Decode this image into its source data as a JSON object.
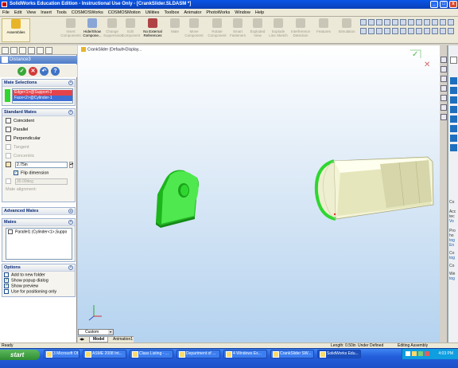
{
  "window": {
    "title": "SolidWorks Education Edition - Instructional Use Only - [CrankSlider.SLDASM *]",
    "minimize": "_",
    "maximize": "□",
    "close": "x"
  },
  "menu": [
    "File",
    "Edit",
    "View",
    "Insert",
    "Tools",
    "COSMOSWorks",
    "COSMOSMotion",
    "Utilities",
    "Toolbox",
    "Animator",
    "PhotoWorks",
    "Window",
    "Help"
  ],
  "toolbar": {
    "assemblies": "Assemblies",
    "buttons": [
      {
        "label": "Insert Components",
        "enabled": false
      },
      {
        "label": "Hide/Show Compone...",
        "enabled": true
      },
      {
        "label": "Change Suppression",
        "enabled": false
      },
      {
        "label": "Edit Component",
        "enabled": false
      },
      {
        "label": "No External References",
        "enabled": true
      },
      {
        "label": "Mate",
        "enabled": false
      },
      {
        "label": "Move Component",
        "enabled": false
      },
      {
        "label": "Rotate Component",
        "enabled": false
      },
      {
        "label": "Smart Fasteners",
        "enabled": false
      },
      {
        "label": "Exploded View",
        "enabled": false
      },
      {
        "label": "Explode Line Sketch",
        "enabled": false
      },
      {
        "label": "Interference Detection",
        "enabled": false
      },
      {
        "label": "Features",
        "enabled": false
      },
      {
        "label": "Simulation",
        "enabled": false
      }
    ]
  },
  "property_manager": {
    "title": "Distance3",
    "mate_selections": {
      "header": "Mate Selections",
      "items": [
        "Edge<1>@Support-3",
        "Face<2>@Cylinder-1"
      ]
    },
    "standard_mates": {
      "header": "Standard Mates",
      "coincident": "Coincident",
      "parallel": "Parallel",
      "perpendicular": "Perpendicular",
      "tangent": "Tangent",
      "concentric": "Concentric",
      "distance_value": "2.75in",
      "flip_dimension": "Flip dimension",
      "angle_value": "30.00deg",
      "mate_alignment": "Mate alignment:"
    },
    "advanced_mates": {
      "header": "Advanced Mates"
    },
    "mates": {
      "header": "Mates",
      "items": [
        "Parallel1 (Cylinder<1>,Suppo"
      ]
    },
    "options": {
      "header": "Options",
      "items": [
        {
          "label": "Add to new folder",
          "checked": false
        },
        {
          "label": "Show popup dialog",
          "checked": true
        },
        {
          "label": "Show preview",
          "checked": true
        },
        {
          "label": "Use for positioning only",
          "checked": false
        }
      ]
    }
  },
  "viewport": {
    "breadcrumb": "CrankSlider (Default<Display...",
    "view_dropdown": "Custom",
    "tabs": [
      "Model",
      "Animation1"
    ]
  },
  "task_pane": {
    "items": [
      "Co",
      "Acc",
      "tec",
      "Vo",
      "Pro",
      "ho",
      "tog",
      "En",
      "Co",
      "tog",
      "Co",
      "We",
      "tog"
    ]
  },
  "status": {
    "left": "Ready",
    "length": "Length: 0.50in",
    "defined": "Under Defined",
    "mode": "Editing Assembly"
  },
  "taskbar": {
    "start": "start",
    "items": [
      "3 Microsoft Of...",
      "ASME 2008 Int...",
      "Class Listing - ...",
      "Department of ...",
      "4 Windows Ex...",
      "CrankSlider SW...",
      "SolidWorks Edu..."
    ],
    "clock": "4:03 PM"
  },
  "colors": {
    "part_green": "#2fd62f",
    "selection_red": "#e4434b",
    "selection_blue": "#3f6fd2",
    "title_blue": "#0a55e6"
  }
}
